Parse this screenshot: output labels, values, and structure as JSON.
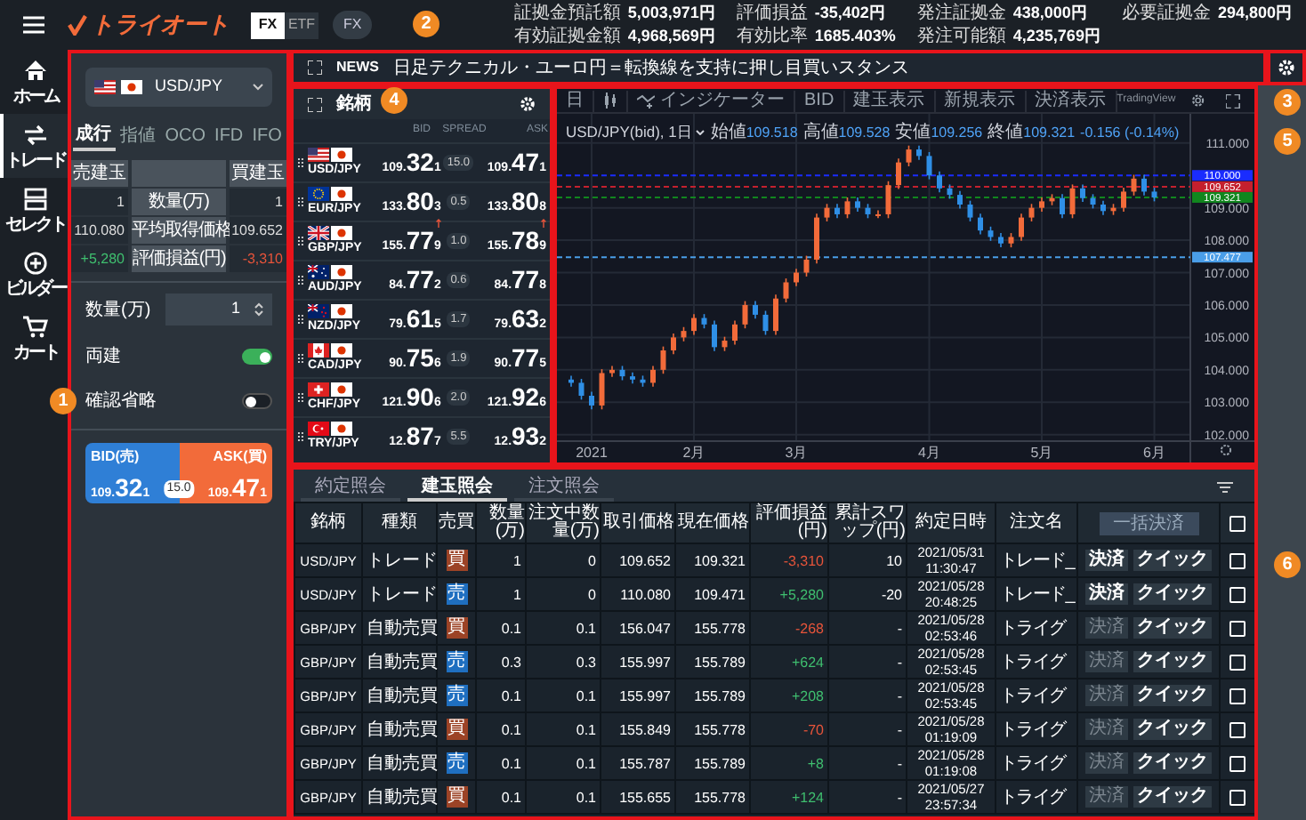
{
  "header": {
    "logo": "トライオート",
    "market_tabs": [
      {
        "label": "FX",
        "selected": true
      },
      {
        "label": "ETF",
        "selected": false
      }
    ],
    "mode_badge": "FX",
    "stats": [
      {
        "label": "証拠金預託額",
        "value": "5,003,971円"
      },
      {
        "label": "評価損益",
        "value": "-35,402円"
      },
      {
        "label": "発注証拠金",
        "value": "438,000円"
      },
      {
        "label": "必要証拠金",
        "value": "294,800円"
      },
      {
        "label": "有効証拠金額",
        "value": "4,968,569円"
      },
      {
        "label": "有効比率",
        "value": "1685.403%"
      },
      {
        "label": "発注可能額",
        "value": "4,235,769円"
      }
    ]
  },
  "nav": [
    {
      "kind": "home",
      "label": "ホーム",
      "selected": false
    },
    {
      "kind": "trade",
      "label": "トレード",
      "selected": true
    },
    {
      "kind": "select",
      "label": "セレクト",
      "selected": false
    },
    {
      "kind": "builder",
      "label": "ビルダー",
      "selected": false
    },
    {
      "kind": "cart",
      "label": "カート",
      "selected": false
    }
  ],
  "order_panel": {
    "pair": {
      "label": "USD/JPY",
      "flags": [
        {
          "kind": "us"
        },
        {
          "kind": "jp"
        }
      ]
    },
    "order_types": [
      {
        "label": "成行",
        "selected": true
      },
      {
        "label": "指値",
        "selected": false
      },
      {
        "label": "OCO",
        "selected": false
      },
      {
        "label": "IFD",
        "selected": false
      },
      {
        "label": "IFO",
        "selected": false
      }
    ],
    "position_summary": {
      "sell_header": "売建玉",
      "buy_header": "買建玉",
      "rows": [
        {
          "label": "数量(万)",
          "sell": {
            "value": "1",
            "kind": "plain"
          },
          "buy": {
            "value": "1",
            "kind": "plain"
          }
        },
        {
          "label": "平均取得価格",
          "sell": {
            "value": "110.080",
            "kind": "plain"
          },
          "buy": {
            "value": "109.652",
            "kind": "plain"
          }
        },
        {
          "label": "評価損益(円)",
          "sell": {
            "value": "+5,280",
            "kind": "gain"
          },
          "buy": {
            "value": "-3,310",
            "kind": "loss"
          }
        }
      ]
    },
    "quantity": {
      "label": "数量(万)",
      "value": "1"
    },
    "toggles": [
      {
        "label": "両建",
        "on": true
      },
      {
        "label": "確認省略",
        "on": false
      }
    ],
    "quote": {
      "bid_label": "BID(売)",
      "bid": {
        "head": "109.",
        "big": "32",
        "tail": "1"
      },
      "spread": "15.0",
      "ask_label": "ASK(買)",
      "ask": {
        "head": "109.",
        "big": "47",
        "tail": "1"
      }
    }
  },
  "news": {
    "tag": "NEWS",
    "headline": "日足テクニカル・ユーロ円＝転換線を支持に押し目買いスタンス"
  },
  "rates": {
    "title": "銘柄",
    "columns": [
      "BID",
      "SPREAD",
      "ASK"
    ],
    "rows": [
      {
        "pair": "USD/JPY",
        "flags": [
          {
            "kind": "us"
          },
          {
            "kind": "jp"
          }
        ],
        "bid": {
          "head": "109.",
          "big": "32",
          "tail": "1"
        },
        "spread": "15.0",
        "ask": {
          "head": "109.",
          "big": "47",
          "tail": "1"
        },
        "rising": false
      },
      {
        "pair": "EUR/JPY",
        "flags": [
          {
            "kind": "eu"
          },
          {
            "kind": "jp"
          }
        ],
        "bid": {
          "head": "133.",
          "big": "80",
          "tail": "3"
        },
        "spread": "0.5",
        "ask": {
          "head": "133.",
          "big": "80",
          "tail": "8"
        },
        "rising": false
      },
      {
        "pair": "GBP/JPY",
        "flags": [
          {
            "kind": "gb"
          },
          {
            "kind": "jp"
          }
        ],
        "bid": {
          "head": "155.",
          "big": "77",
          "tail": "9"
        },
        "spread": "1.0",
        "ask": {
          "head": "155.",
          "big": "78",
          "tail": "9"
        },
        "rising": true
      },
      {
        "pair": "AUD/JPY",
        "flags": [
          {
            "kind": "au"
          },
          {
            "kind": "jp"
          }
        ],
        "bid": {
          "head": "84.",
          "big": "77",
          "tail": "2"
        },
        "spread": "0.6",
        "ask": {
          "head": "84.",
          "big": "77",
          "tail": "8"
        },
        "rising": false
      },
      {
        "pair": "NZD/JPY",
        "flags": [
          {
            "kind": "nz"
          },
          {
            "kind": "jp"
          }
        ],
        "bid": {
          "head": "79.",
          "big": "61",
          "tail": "5"
        },
        "spread": "1.7",
        "ask": {
          "head": "79.",
          "big": "63",
          "tail": "2"
        },
        "rising": false
      },
      {
        "pair": "CAD/JPY",
        "flags": [
          {
            "kind": "ca"
          },
          {
            "kind": "jp"
          }
        ],
        "bid": {
          "head": "90.",
          "big": "75",
          "tail": "6"
        },
        "spread": "1.9",
        "ask": {
          "head": "90.",
          "big": "77",
          "tail": "5"
        },
        "rising": false
      },
      {
        "pair": "CHF/JPY",
        "flags": [
          {
            "kind": "ch"
          },
          {
            "kind": "jp"
          }
        ],
        "bid": {
          "head": "121.",
          "big": "90",
          "tail": "6"
        },
        "spread": "2.0",
        "ask": {
          "head": "121.",
          "big": "92",
          "tail": "6"
        },
        "rising": false
      },
      {
        "pair": "TRY/JPY",
        "flags": [
          {
            "kind": "tr"
          },
          {
            "kind": "jp"
          }
        ],
        "bid": {
          "head": "12.",
          "big": "87",
          "tail": "7"
        },
        "spread": "5.5",
        "ask": {
          "head": "12.",
          "big": "93",
          "tail": "2"
        },
        "rising": false
      }
    ]
  },
  "chart": {
    "toolbar": [
      {
        "kind": "text",
        "label": "日"
      },
      {
        "kind": "candles"
      },
      {
        "kind": "indicator",
        "label": "インジケーター"
      },
      {
        "kind": "text",
        "label": "BID"
      },
      {
        "kind": "text",
        "label": "建玉表示"
      },
      {
        "kind": "text",
        "label": "新規表示"
      },
      {
        "kind": "text",
        "label": "決済表示"
      }
    ],
    "brand": "TradingView",
    "legend": {
      "symbol": "USD/JPY(bid), 1日",
      "stats": [
        {
          "label": "始値",
          "value": "109.518"
        },
        {
          "label": "高値",
          "value": "109.528"
        },
        {
          "label": "安値",
          "value": "109.256"
        },
        {
          "label": "終値",
          "value": "109.321"
        }
      ],
      "change": "-0.156 (-0.14%)"
    },
    "chart_data": {
      "type": "candlestick",
      "grid": true,
      "ylim": [
        101.8,
        111.9
      ],
      "categories": [
        null,
        null,
        "2021",
        null,
        null,
        null,
        null,
        null,
        null,
        null,
        null,
        null,
        "2月",
        null,
        null,
        null,
        null,
        null,
        null,
        null,
        null,
        null,
        "3月",
        null,
        null,
        null,
        null,
        null,
        null,
        null,
        null,
        null,
        null,
        null,
        null,
        "4月",
        null,
        null,
        null,
        null,
        null,
        null,
        null,
        null,
        null,
        null,
        "5月",
        null,
        null,
        null,
        null,
        null,
        null,
        null,
        null,
        null,
        null,
        "6月"
      ],
      "ohlc": [
        [
          103.7,
          103.82,
          103.48,
          103.6
        ],
        [
          103.6,
          103.72,
          103.08,
          103.2
        ],
        [
          103.2,
          103.32,
          102.78,
          102.9
        ],
        [
          102.9,
          104.02,
          102.78,
          103.9
        ],
        [
          103.9,
          104.12,
          103.78,
          104.0
        ],
        [
          104.0,
          104.12,
          103.68,
          103.8
        ],
        [
          103.8,
          103.92,
          103.58,
          103.7
        ],
        [
          103.7,
          103.82,
          103.48,
          103.6
        ],
        [
          103.6,
          104.12,
          103.48,
          104.0
        ],
        [
          104.0,
          104.72,
          103.88,
          104.6
        ],
        [
          104.6,
          105.12,
          104.48,
          105.0
        ],
        [
          105.0,
          105.32,
          104.88,
          105.2
        ],
        [
          105.2,
          105.72,
          105.08,
          105.6
        ],
        [
          105.6,
          105.72,
          105.28,
          105.4
        ],
        [
          105.4,
          105.52,
          104.58,
          104.7
        ],
        [
          104.7,
          105.02,
          104.58,
          104.9
        ],
        [
          104.9,
          105.52,
          104.78,
          105.4
        ],
        [
          105.4,
          106.12,
          105.28,
          106.0
        ],
        [
          106.0,
          106.12,
          105.58,
          105.7
        ],
        [
          105.7,
          105.82,
          105.08,
          105.2
        ],
        [
          105.2,
          106.32,
          105.08,
          106.2
        ],
        [
          106.2,
          106.82,
          106.08,
          106.7
        ],
        [
          106.7,
          107.12,
          106.58,
          107.0
        ],
        [
          107.0,
          107.52,
          106.88,
          107.4
        ],
        [
          107.4,
          108.82,
          107.28,
          108.7
        ],
        [
          108.7,
          109.12,
          108.58,
          109.0
        ],
        [
          109.0,
          109.12,
          108.68,
          108.8
        ],
        [
          108.8,
          109.32,
          108.68,
          109.2
        ],
        [
          109.2,
          109.32,
          108.88,
          109.0
        ],
        [
          109.0,
          109.12,
          108.68,
          108.8
        ],
        [
          108.8,
          108.92,
          108.68,
          108.8
        ],
        [
          108.8,
          109.82,
          108.68,
          109.7
        ],
        [
          109.7,
          110.52,
          109.58,
          110.4
        ],
        [
          110.4,
          110.92,
          110.28,
          110.8
        ],
        [
          110.8,
          110.92,
          110.48,
          110.6
        ],
        [
          110.6,
          110.72,
          109.88,
          110.0
        ],
        [
          110.0,
          110.12,
          109.48,
          109.6
        ],
        [
          109.6,
          109.72,
          109.28,
          109.4
        ],
        [
          109.4,
          109.52,
          108.98,
          109.1
        ],
        [
          109.1,
          109.22,
          108.58,
          108.7
        ],
        [
          108.7,
          108.82,
          108.18,
          108.3
        ],
        [
          108.3,
          108.42,
          107.98,
          108.1
        ],
        [
          108.1,
          108.22,
          107.78,
          107.9
        ],
        [
          107.9,
          108.22,
          107.78,
          108.1
        ],
        [
          108.1,
          108.82,
          107.98,
          108.7
        ],
        [
          108.7,
          109.12,
          108.58,
          109.0
        ],
        [
          109.0,
          109.32,
          108.88,
          109.2
        ],
        [
          109.2,
          109.42,
          109.08,
          109.3
        ],
        [
          109.3,
          109.42,
          108.68,
          108.8
        ],
        [
          108.8,
          109.72,
          108.68,
          109.6
        ],
        [
          109.6,
          109.72,
          109.18,
          109.3
        ],
        [
          109.3,
          109.42,
          108.98,
          109.1
        ],
        [
          109.1,
          109.22,
          108.78,
          108.9
        ],
        [
          108.9,
          109.12,
          108.78,
          109.0
        ],
        [
          109.0,
          109.62,
          108.88,
          109.5
        ],
        [
          109.5,
          110.02,
          109.38,
          109.9
        ],
        [
          109.9,
          110.02,
          109.38,
          109.5
        ],
        [
          109.5,
          109.62,
          109.2,
          109.32
        ]
      ],
      "yticks": [
        {
          "value": 102,
          "label": "102.000"
        },
        {
          "value": 103,
          "label": "103.000"
        },
        {
          "value": 104,
          "label": "104.000"
        },
        {
          "value": 105,
          "label": "105.000"
        },
        {
          "value": 106,
          "label": "106.000"
        },
        {
          "value": 107,
          "label": "107.000"
        },
        {
          "value": 108,
          "label": "108.000"
        },
        {
          "value": 109,
          "label": "109.000"
        },
        {
          "value": 111,
          "label": "111.000"
        }
      ],
      "ref_lines": [
        {
          "axis": "y",
          "value": 110.0,
          "label": "110.000",
          "color": "#1a2cff"
        },
        {
          "axis": "y",
          "value": 109.652,
          "label": "109.652",
          "color": "#c4202e"
        },
        {
          "axis": "y",
          "value": 109.321,
          "label": "109.321",
          "color": "#11861e"
        },
        {
          "axis": "y",
          "value": 107.477,
          "label": "107.477",
          "color": "#4a9ee8"
        }
      ]
    }
  },
  "positions": {
    "tabs": [
      {
        "label": "約定照会",
        "selected": false
      },
      {
        "label": "建玉照会",
        "selected": true
      },
      {
        "label": "注文照会",
        "selected": false
      }
    ],
    "columns": [
      "銘柄",
      "種類",
      "売買",
      "数量(万)",
      "注文中数量(万)",
      "取引価格",
      "現在価格",
      "評価損益(円)",
      "累計スワップ(円)",
      "約定日時",
      "注文名"
    ],
    "bulk_button": "一括決済",
    "all_checked": false,
    "rows": [
      {
        "symbol": "USD/JPY",
        "type": "トレード",
        "side": {
          "label": "買",
          "kind": "buy"
        },
        "qty": "1",
        "pending": "0",
        "price": "109.652",
        "current": "109.321",
        "pnl": {
          "value": "-3,310",
          "kind": "loss"
        },
        "swap": "10",
        "date": "2021/05/31",
        "time": "11:30:47",
        "name": "トレード_",
        "settle": "決済",
        "settle_enabled": true,
        "quick": "クイック",
        "checked": false
      },
      {
        "symbol": "USD/JPY",
        "type": "トレード",
        "side": {
          "label": "売",
          "kind": "sell"
        },
        "qty": "1",
        "pending": "0",
        "price": "110.080",
        "current": "109.471",
        "pnl": {
          "value": "+5,280",
          "kind": "gain"
        },
        "swap": "-20",
        "date": "2021/05/28",
        "time": "20:48:25",
        "name": "トレード_",
        "settle": "決済",
        "settle_enabled": true,
        "quick": "クイック",
        "checked": false
      },
      {
        "symbol": "GBP/JPY",
        "type": "自動売買",
        "side": {
          "label": "買",
          "kind": "buy"
        },
        "qty": "0.1",
        "pending": "0.1",
        "price": "156.047",
        "current": "155.778",
        "pnl": {
          "value": "-268",
          "kind": "loss"
        },
        "swap": "-",
        "date": "2021/05/28",
        "time": "02:53:46",
        "name": "トライグ",
        "settle": "決済",
        "settle_enabled": false,
        "quick": "クイック",
        "checked": false
      },
      {
        "symbol": "GBP/JPY",
        "type": "自動売買",
        "side": {
          "label": "売",
          "kind": "sell"
        },
        "qty": "0.3",
        "pending": "0.3",
        "price": "155.997",
        "current": "155.789",
        "pnl": {
          "value": "+624",
          "kind": "gain"
        },
        "swap": "-",
        "date": "2021/05/28",
        "time": "02:53:45",
        "name": "トライグ",
        "settle": "決済",
        "settle_enabled": false,
        "quick": "クイック",
        "checked": false
      },
      {
        "symbol": "GBP/JPY",
        "type": "自動売買",
        "side": {
          "label": "売",
          "kind": "sell"
        },
        "qty": "0.1",
        "pending": "0.1",
        "price": "155.997",
        "current": "155.789",
        "pnl": {
          "value": "+208",
          "kind": "gain"
        },
        "swap": "-",
        "date": "2021/05/28",
        "time": "02:53:45",
        "name": "トライグ",
        "settle": "決済",
        "settle_enabled": false,
        "quick": "クイック",
        "checked": false
      },
      {
        "symbol": "GBP/JPY",
        "type": "自動売買",
        "side": {
          "label": "買",
          "kind": "buy"
        },
        "qty": "0.1",
        "pending": "0.1",
        "price": "155.849",
        "current": "155.778",
        "pnl": {
          "value": "-70",
          "kind": "loss"
        },
        "swap": "-",
        "date": "2021/05/28",
        "time": "01:19:09",
        "name": "トライグ",
        "settle": "決済",
        "settle_enabled": false,
        "quick": "クイック",
        "checked": false
      },
      {
        "symbol": "GBP/JPY",
        "type": "自動売買",
        "side": {
          "label": "売",
          "kind": "sell"
        },
        "qty": "0.1",
        "pending": "0.1",
        "price": "155.787",
        "current": "155.789",
        "pnl": {
          "value": "+8",
          "kind": "gain"
        },
        "swap": "-",
        "date": "2021/05/28",
        "time": "01:19:08",
        "name": "トライグ",
        "settle": "決済",
        "settle_enabled": false,
        "quick": "クイック",
        "checked": false
      },
      {
        "symbol": "GBP/JPY",
        "type": "自動売買",
        "side": {
          "label": "買",
          "kind": "buy"
        },
        "qty": "0.1",
        "pending": "0.1",
        "price": "155.655",
        "current": "155.778",
        "pnl": {
          "value": "+124",
          "kind": "gain"
        },
        "swap": "-",
        "date": "2021/05/27",
        "time": "23:57:34",
        "name": "トライグ",
        "settle": "決済",
        "settle_enabled": false,
        "quick": "クイック",
        "checked": false
      }
    ]
  },
  "callouts": [
    "1",
    "2",
    "3",
    "4",
    "5",
    "6"
  ]
}
